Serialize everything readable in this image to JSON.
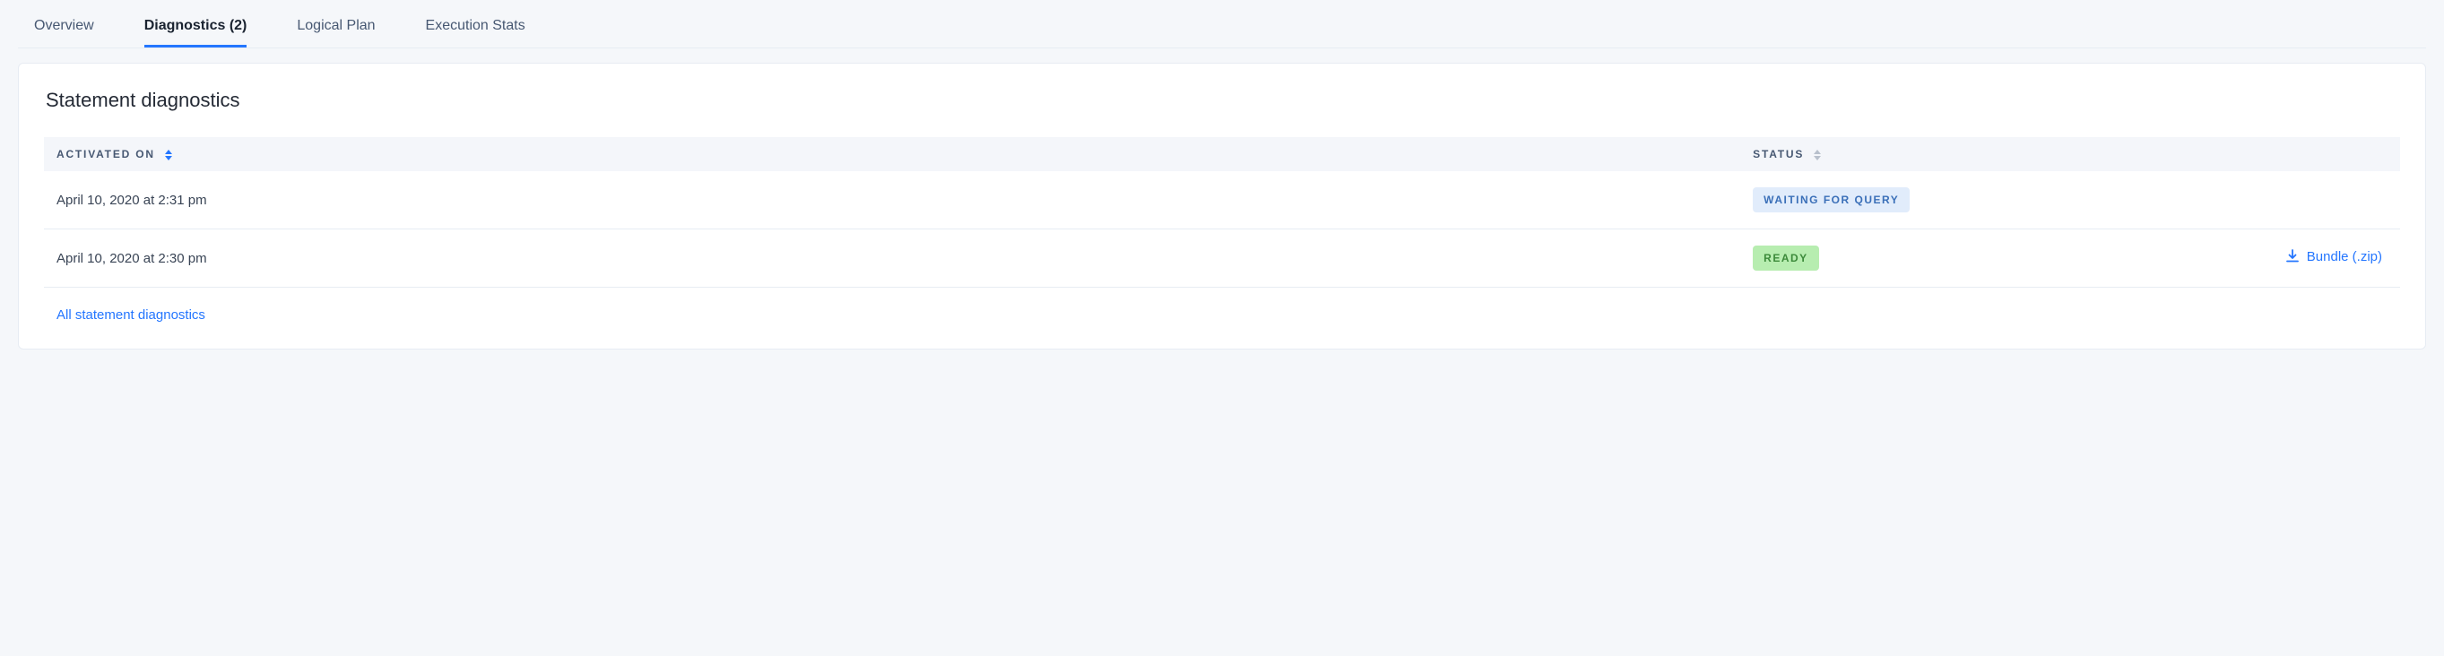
{
  "tabs": [
    {
      "label": "Overview"
    },
    {
      "label": "Diagnostics (2)"
    },
    {
      "label": "Logical Plan"
    },
    {
      "label": "Execution Stats"
    }
  ],
  "card": {
    "title": "Statement diagnostics",
    "columns": {
      "activated_on": "Activated on",
      "status": "Status"
    },
    "rows": [
      {
        "activated_on": "April 10, 2020 at 2:31 pm",
        "status_label": "WAITING FOR QUERY",
        "status_kind": "waiting",
        "download_label": ""
      },
      {
        "activated_on": "April 10, 2020 at 2:30 pm",
        "status_label": "READY",
        "status_kind": "ready",
        "download_label": "Bundle (.zip)"
      }
    ],
    "footer_link": "All statement diagnostics"
  },
  "colors": {
    "accent": "#2476ff",
    "badge_waiting_bg": "#e1ecfb",
    "badge_waiting_fg": "#3a6fb8",
    "badge_ready_bg": "#b7edb0",
    "badge_ready_fg": "#3c8a3a"
  }
}
